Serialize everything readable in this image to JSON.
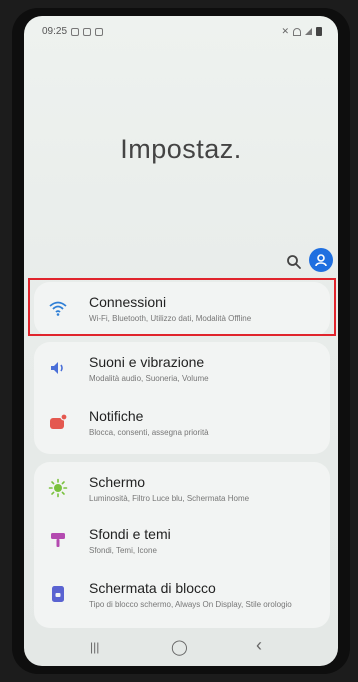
{
  "status_bar": {
    "time": "09:25",
    "left_icons": [
      "notification-icon",
      "notification-icon",
      "notification-icon"
    ],
    "right_icons": [
      "mute-icon",
      "wifi-status-icon",
      "signal-icon",
      "battery-icon"
    ]
  },
  "header": {
    "title": "Impostaz."
  },
  "settings": {
    "groups": [
      {
        "items": [
          {
            "title": "Connessioni",
            "subtitle": "Wi-Fi, Bluetooth, Utilizzo dati, Modalità Offline",
            "icon": "wifi-icon",
            "color": "#2f7fd6"
          }
        ]
      },
      {
        "items": [
          {
            "title": "Suoni e vibrazione",
            "subtitle": "Modalità audio, Suoneria, Volume",
            "icon": "volume-icon",
            "color": "#4a6fd8"
          },
          {
            "title": "Notifiche",
            "subtitle": "Blocca, consenti, assegna priorità",
            "icon": "notification-bell-icon",
            "color": "#e4584f"
          }
        ]
      },
      {
        "items": [
          {
            "title": "Schermo",
            "subtitle": "Luminosità, Filtro Luce blu, Schermata Home",
            "icon": "brightness-icon",
            "color": "#7ac13e"
          },
          {
            "title": "Sfondi e temi",
            "subtitle": "Sfondi, Temi, Icone",
            "icon": "palette-icon",
            "color": "#b44ab0"
          },
          {
            "title": "Schermata di blocco",
            "subtitle": "Tipo di blocco schermo, Always On Display, Stile orologio",
            "icon": "lock-screen-icon",
            "color": "#5a63d1"
          }
        ]
      }
    ]
  },
  "nav_bar": {
    "recent": "|||",
    "home": "◯",
    "back": "‹"
  },
  "colors": {
    "highlight": "#e0242c",
    "accent": "#1f6fe0"
  }
}
